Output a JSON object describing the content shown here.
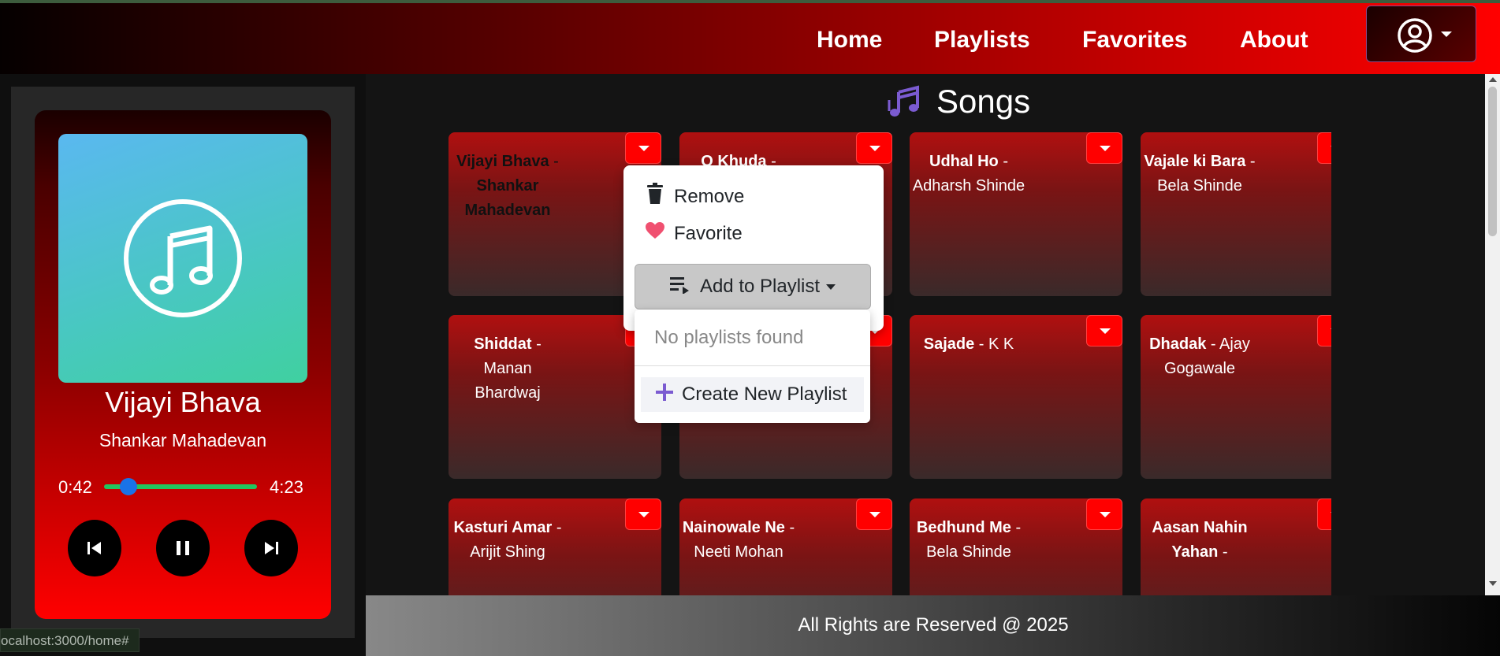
{
  "nav": {
    "links": [
      "Home",
      "Playlists",
      "Favorites",
      "About"
    ],
    "profile_icon": "user-circle-icon"
  },
  "player": {
    "title": "Vijayi Bhava",
    "artist": "Shankar Mahadevan",
    "current_time": "0:42",
    "total_time": "4:23",
    "progress": 0.16
  },
  "main": {
    "heading": "Songs",
    "songs": [
      {
        "title": "Vijayi Bhava",
        "artist": "Shankar Mahadevan"
      },
      {
        "title": "O Khuda",
        "artist": ""
      },
      {
        "title": "Udhal Ho",
        "artist": "Adharsh Shinde"
      },
      {
        "title": "Vajale ki Bara",
        "artist": "Bela Shinde"
      },
      {
        "title": "Shiddat",
        "artist": "Manan Bhardwaj"
      },
      {
        "title": "",
        "artist": ""
      },
      {
        "title": "Sajade",
        "artist": "K K"
      },
      {
        "title": "Dhadak",
        "artist": "Ajay Gogawale"
      },
      {
        "title": "Kasturi Amar",
        "artist": "Arijit Shing"
      },
      {
        "title": "Nainowale Ne",
        "artist": "Neeti Mohan"
      },
      {
        "title": "Bedhund Me",
        "artist": "Bela Shinde"
      },
      {
        "title": "Aasan Nahin Yahan",
        "artist": ""
      }
    ]
  },
  "menu": {
    "remove": "Remove",
    "favorite": "Favorite",
    "add_to_playlist": "Add to Playlist",
    "no_playlists": "No playlists found",
    "create_playlist": "Create New Playlist"
  },
  "footer": {
    "text": "All Rights are Reserved @ 2025"
  },
  "status_bar": {
    "url": "ocalhost:3000/home#"
  }
}
